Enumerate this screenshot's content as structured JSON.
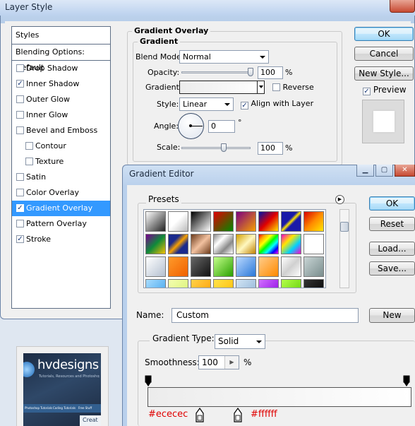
{
  "layer_style": {
    "title": "Layer Style",
    "styles_header": "Styles",
    "blending_options": "Blending Options: Default",
    "items": [
      {
        "label": "Drop Shadow",
        "checked": false
      },
      {
        "label": "Inner Shadow",
        "checked": true
      },
      {
        "label": "Outer Glow",
        "checked": false
      },
      {
        "label": "Inner Glow",
        "checked": false
      },
      {
        "label": "Bevel and Emboss",
        "checked": false
      },
      {
        "label": "Contour",
        "checked": false
      },
      {
        "label": "Texture",
        "checked": false
      },
      {
        "label": "Satin",
        "checked": false
      },
      {
        "label": "Color Overlay",
        "checked": false
      },
      {
        "label": "Gradient Overlay",
        "checked": true,
        "selected": true
      },
      {
        "label": "Pattern Overlay",
        "checked": false
      },
      {
        "label": "Stroke",
        "checked": true
      }
    ],
    "check_mark": "✓",
    "gradient_overlay": {
      "group_title": "Gradient Overlay",
      "subgroup_title": "Gradient",
      "blend_mode_label": "Blend Mode:",
      "blend_mode_value": "Normal",
      "opacity_label": "Opacity:",
      "opacity_value": "100",
      "opacity_level": 1.0,
      "percent": "%",
      "gradient_label": "Gradient:",
      "reverse_label": "Reverse",
      "style_label": "Style:",
      "style_value": "Linear",
      "align_label": "Align with Layer",
      "align_checked": true,
      "angle_label": "Angle:",
      "angle_value": "0",
      "degree": "°",
      "scale_label": "Scale:",
      "scale_value": "100",
      "scale_level": 0.6
    },
    "buttons": {
      "ok": "OK",
      "cancel": "Cancel",
      "new_style": "New Style...",
      "preview_label": "Preview"
    }
  },
  "thumbnail": {
    "brand": "hvdesigns",
    "tagline": "Tutorials, Resources and Photoshop Products",
    "tabs": [
      "Photoshop Tutorials",
      "Coding Tutorials",
      "Free Stuff"
    ],
    "heading": "Creat"
  },
  "gradient_editor": {
    "title": "Gradient Editor",
    "presets_label": "Presets",
    "buttons": {
      "ok": "OK",
      "reset": "Reset",
      "load": "Load...",
      "save": "Save...",
      "new": "New"
    },
    "name_label": "Name:",
    "name_value": "Custom",
    "gradient_type_label": "Gradient Type:",
    "gradient_type_value": "Solid",
    "smoothness_label": "Smoothness:",
    "smoothness_value": "100",
    "percent": "%",
    "annotations": [
      "#ececec",
      "#ffffff"
    ],
    "colors": {
      "start": "#ececec",
      "end": "#ffffff",
      "selection": "#3399ff",
      "annotation": "#e00000"
    }
  }
}
